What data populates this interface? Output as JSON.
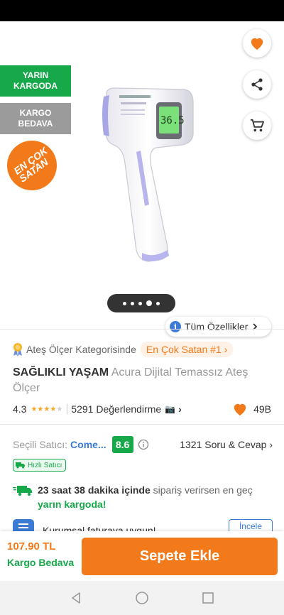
{
  "badges": {
    "next_day_line1": "YARIN",
    "next_day_line2": "KARGODA",
    "free_ship_line1": "KARGO",
    "free_ship_line2": "BEDAVA",
    "best_seller_line1": "EN ÇOK",
    "best_seller_line2": "SATAN"
  },
  "gallery": {
    "image_count": 5,
    "active_index": 4,
    "all_specs_label": "Tüm Özellikler"
  },
  "category": {
    "label": "Ateş Ölçer Kategorisinde",
    "rank": "En Çok Satan #1"
  },
  "product": {
    "brand": "SAĞLIKLI YAŞAM",
    "name": "Acura Dijital Temassız Ateş Ölçer"
  },
  "rating": {
    "score": "4.3",
    "stars": 4.3,
    "reviews": "5291 Değerlendirme",
    "likes": "49B"
  },
  "seller": {
    "label": "Seçili Satıcı:",
    "name": "Come...",
    "score": "8.6",
    "qa": "1321 Soru & Cevap",
    "fast_badge": "Hızlı Satıcı"
  },
  "delivery": {
    "time": "23 saat 38 dakika içinde",
    "middle": "sipariş verirsen en geç",
    "highlight": "yarın kargoda!"
  },
  "invoice": {
    "text": "Kurumsal faturaya uygun!",
    "button": "İncele"
  },
  "bottom": {
    "price": "107.90 TL",
    "shipping": "Kargo Bedava",
    "add_to_cart": "Sepete Ekle"
  },
  "colors": {
    "accent": "#f27a1a",
    "green": "#17a84a",
    "blue": "#3b7bd6"
  }
}
